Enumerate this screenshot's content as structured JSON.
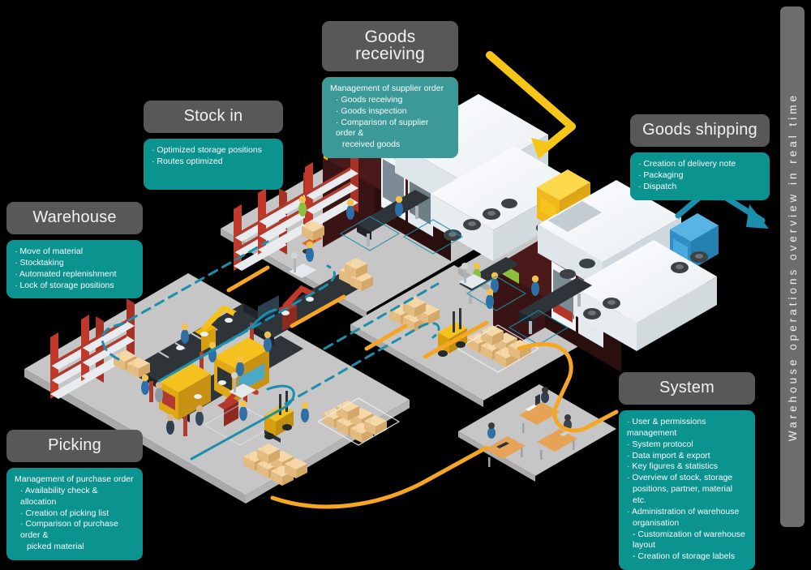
{
  "banner": {
    "text": "Warehouse operations overview in real time"
  },
  "colors": {
    "header_gray": "#585858",
    "teal": "#0b9390",
    "teal_soft": "#3b9a98",
    "banner_gray": "#6d6d6d",
    "arrow_yellow": "#f5c518",
    "arrow_blue": "#1b8fab",
    "route_orange": "#f6a623",
    "floor_gray": "#c6c6c6",
    "background": "#000000"
  },
  "cards": {
    "goods_receiving": {
      "title": "Goods receiving",
      "items": [
        {
          "text": "Management of supplier order",
          "level": 0
        },
        {
          "text": "· Goods receiving",
          "level": 1
        },
        {
          "text": "· Goods inspection",
          "level": 1
        },
        {
          "text": "· Comparison of supplier order &",
          "level": 1
        },
        {
          "text": "received goods",
          "level": 1
        }
      ]
    },
    "stock_in": {
      "title": "Stock in",
      "items": [
        {
          "text": "· Optimized storage positions",
          "level": 0
        },
        {
          "text": "· Routes optimized",
          "level": 0
        }
      ]
    },
    "warehouse": {
      "title": "Warehouse",
      "items": [
        {
          "text": "· Move of material",
          "level": 0
        },
        {
          "text": "· Stocktaking",
          "level": 0
        },
        {
          "text": "· Automated replenishment",
          "level": 0
        },
        {
          "text": "· Lock of storage positions",
          "level": 0
        }
      ]
    },
    "goods_shipping": {
      "title": "Goods shipping",
      "items": [
        {
          "text": "· Creation of delivery note",
          "level": 0
        },
        {
          "text": "· Packaging",
          "level": 0
        },
        {
          "text": "· Dispatch",
          "level": 0
        }
      ]
    },
    "system": {
      "title": "System",
      "items": [
        {
          "text": "· User & permissions management",
          "level": 0
        },
        {
          "text": "· System protocol",
          "level": 0
        },
        {
          "text": "· Data import & export",
          "level": 0
        },
        {
          "text": "· Key figures & statistics",
          "level": 0
        },
        {
          "text": "· Overview of stock, storage",
          "level": 0
        },
        {
          "text": "positions, partner, material etc.",
          "level": 1
        },
        {
          "text": "· Administration of warehouse",
          "level": 0
        },
        {
          "text": "organisation",
          "level": 1
        },
        {
          "text": "- Customization of warehouse layout",
          "level": 1
        },
        {
          "text": "- Creation of storage labels",
          "level": 1
        }
      ]
    },
    "picking": {
      "title": "Picking",
      "items": [
        {
          "text": "Management of purchase order",
          "level": 0
        },
        {
          "text": "· Availability check & allocation",
          "level": 1
        },
        {
          "text": "· Creation of picking list",
          "level": 1
        },
        {
          "text": "· Comparison of purchase order &",
          "level": 1
        },
        {
          "text": "picked material",
          "level": 1
        }
      ]
    }
  },
  "scene": {
    "platforms": [
      {
        "name": "production-floor",
        "label": "main production / picking floor"
      },
      {
        "name": "stock-in-dock",
        "label": "stock in receiving dock"
      },
      {
        "name": "shipping-dock",
        "label": "goods shipping dock"
      },
      {
        "name": "staging-floor",
        "label": "pallet staging floor"
      },
      {
        "name": "office-floor",
        "label": "system office floor"
      }
    ],
    "vehicles": [
      {
        "name": "yellow-truck",
        "color": "#f5bf1c"
      },
      {
        "name": "blue-truck",
        "color": "#3a9fd4"
      },
      {
        "name": "forklift-left",
        "color": "#f2b500"
      },
      {
        "name": "forklift-right",
        "color": "#f2b500"
      }
    ],
    "arrows": [
      {
        "name": "inbound-arrow",
        "color": "#f5c518"
      },
      {
        "name": "outbound-arrow",
        "color": "#1b8fab"
      }
    ]
  }
}
